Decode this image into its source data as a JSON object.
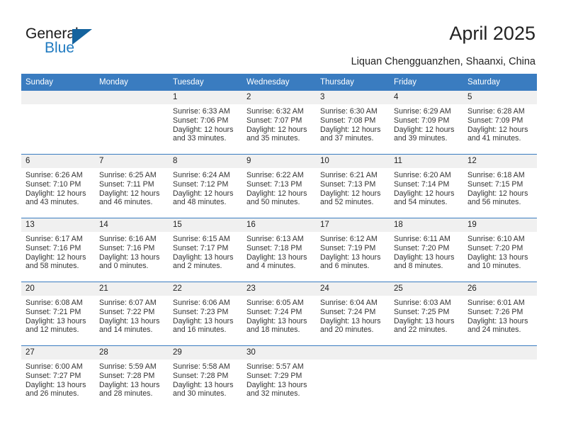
{
  "brand": {
    "word_general": "General",
    "word_blue": "Blue",
    "accent_color": "#1f7ac0",
    "triangle_color": "#14639e"
  },
  "header": {
    "title": "April 2025",
    "location": "Liquan Chengguanzhen, Shaanxi, China"
  },
  "calendar": {
    "header_bg": "#3a7cc0",
    "daynum_bg": "#f0f0f0",
    "weekday_headers": [
      "Sunday",
      "Monday",
      "Tuesday",
      "Wednesday",
      "Thursday",
      "Friday",
      "Saturday"
    ],
    "weeks": [
      [
        {
          "day": "",
          "empty": true,
          "lines": []
        },
        {
          "day": "",
          "empty": true,
          "lines": []
        },
        {
          "day": "1",
          "empty": false,
          "lines": [
            "Sunrise: 6:33 AM",
            "Sunset: 7:06 PM",
            "Daylight: 12 hours",
            "and 33 minutes."
          ]
        },
        {
          "day": "2",
          "empty": false,
          "lines": [
            "Sunrise: 6:32 AM",
            "Sunset: 7:07 PM",
            "Daylight: 12 hours",
            "and 35 minutes."
          ]
        },
        {
          "day": "3",
          "empty": false,
          "lines": [
            "Sunrise: 6:30 AM",
            "Sunset: 7:08 PM",
            "Daylight: 12 hours",
            "and 37 minutes."
          ]
        },
        {
          "day": "4",
          "empty": false,
          "lines": [
            "Sunrise: 6:29 AM",
            "Sunset: 7:09 PM",
            "Daylight: 12 hours",
            "and 39 minutes."
          ]
        },
        {
          "day": "5",
          "empty": false,
          "lines": [
            "Sunrise: 6:28 AM",
            "Sunset: 7:09 PM",
            "Daylight: 12 hours",
            "and 41 minutes."
          ]
        }
      ],
      [
        {
          "day": "6",
          "empty": false,
          "lines": [
            "Sunrise: 6:26 AM",
            "Sunset: 7:10 PM",
            "Daylight: 12 hours",
            "and 43 minutes."
          ]
        },
        {
          "day": "7",
          "empty": false,
          "lines": [
            "Sunrise: 6:25 AM",
            "Sunset: 7:11 PM",
            "Daylight: 12 hours",
            "and 46 minutes."
          ]
        },
        {
          "day": "8",
          "empty": false,
          "lines": [
            "Sunrise: 6:24 AM",
            "Sunset: 7:12 PM",
            "Daylight: 12 hours",
            "and 48 minutes."
          ]
        },
        {
          "day": "9",
          "empty": false,
          "lines": [
            "Sunrise: 6:22 AM",
            "Sunset: 7:13 PM",
            "Daylight: 12 hours",
            "and 50 minutes."
          ]
        },
        {
          "day": "10",
          "empty": false,
          "lines": [
            "Sunrise: 6:21 AM",
            "Sunset: 7:13 PM",
            "Daylight: 12 hours",
            "and 52 minutes."
          ]
        },
        {
          "day": "11",
          "empty": false,
          "lines": [
            "Sunrise: 6:20 AM",
            "Sunset: 7:14 PM",
            "Daylight: 12 hours",
            "and 54 minutes."
          ]
        },
        {
          "day": "12",
          "empty": false,
          "lines": [
            "Sunrise: 6:18 AM",
            "Sunset: 7:15 PM",
            "Daylight: 12 hours",
            "and 56 minutes."
          ]
        }
      ],
      [
        {
          "day": "13",
          "empty": false,
          "lines": [
            "Sunrise: 6:17 AM",
            "Sunset: 7:16 PM",
            "Daylight: 12 hours",
            "and 58 minutes."
          ]
        },
        {
          "day": "14",
          "empty": false,
          "lines": [
            "Sunrise: 6:16 AM",
            "Sunset: 7:16 PM",
            "Daylight: 13 hours",
            "and 0 minutes."
          ]
        },
        {
          "day": "15",
          "empty": false,
          "lines": [
            "Sunrise: 6:15 AM",
            "Sunset: 7:17 PM",
            "Daylight: 13 hours",
            "and 2 minutes."
          ]
        },
        {
          "day": "16",
          "empty": false,
          "lines": [
            "Sunrise: 6:13 AM",
            "Sunset: 7:18 PM",
            "Daylight: 13 hours",
            "and 4 minutes."
          ]
        },
        {
          "day": "17",
          "empty": false,
          "lines": [
            "Sunrise: 6:12 AM",
            "Sunset: 7:19 PM",
            "Daylight: 13 hours",
            "and 6 minutes."
          ]
        },
        {
          "day": "18",
          "empty": false,
          "lines": [
            "Sunrise: 6:11 AM",
            "Sunset: 7:20 PM",
            "Daylight: 13 hours",
            "and 8 minutes."
          ]
        },
        {
          "day": "19",
          "empty": false,
          "lines": [
            "Sunrise: 6:10 AM",
            "Sunset: 7:20 PM",
            "Daylight: 13 hours",
            "and 10 minutes."
          ]
        }
      ],
      [
        {
          "day": "20",
          "empty": false,
          "lines": [
            "Sunrise: 6:08 AM",
            "Sunset: 7:21 PM",
            "Daylight: 13 hours",
            "and 12 minutes."
          ]
        },
        {
          "day": "21",
          "empty": false,
          "lines": [
            "Sunrise: 6:07 AM",
            "Sunset: 7:22 PM",
            "Daylight: 13 hours",
            "and 14 minutes."
          ]
        },
        {
          "day": "22",
          "empty": false,
          "lines": [
            "Sunrise: 6:06 AM",
            "Sunset: 7:23 PM",
            "Daylight: 13 hours",
            "and 16 minutes."
          ]
        },
        {
          "day": "23",
          "empty": false,
          "lines": [
            "Sunrise: 6:05 AM",
            "Sunset: 7:24 PM",
            "Daylight: 13 hours",
            "and 18 minutes."
          ]
        },
        {
          "day": "24",
          "empty": false,
          "lines": [
            "Sunrise: 6:04 AM",
            "Sunset: 7:24 PM",
            "Daylight: 13 hours",
            "and 20 minutes."
          ]
        },
        {
          "day": "25",
          "empty": false,
          "lines": [
            "Sunrise: 6:03 AM",
            "Sunset: 7:25 PM",
            "Daylight: 13 hours",
            "and 22 minutes."
          ]
        },
        {
          "day": "26",
          "empty": false,
          "lines": [
            "Sunrise: 6:01 AM",
            "Sunset: 7:26 PM",
            "Daylight: 13 hours",
            "and 24 minutes."
          ]
        }
      ],
      [
        {
          "day": "27",
          "empty": false,
          "lines": [
            "Sunrise: 6:00 AM",
            "Sunset: 7:27 PM",
            "Daylight: 13 hours",
            "and 26 minutes."
          ]
        },
        {
          "day": "28",
          "empty": false,
          "lines": [
            "Sunrise: 5:59 AM",
            "Sunset: 7:28 PM",
            "Daylight: 13 hours",
            "and 28 minutes."
          ]
        },
        {
          "day": "29",
          "empty": false,
          "lines": [
            "Sunrise: 5:58 AM",
            "Sunset: 7:28 PM",
            "Daylight: 13 hours",
            "and 30 minutes."
          ]
        },
        {
          "day": "30",
          "empty": false,
          "lines": [
            "Sunrise: 5:57 AM",
            "Sunset: 7:29 PM",
            "Daylight: 13 hours",
            "and 32 minutes."
          ]
        },
        {
          "day": "",
          "empty": true,
          "lines": []
        },
        {
          "day": "",
          "empty": true,
          "lines": []
        },
        {
          "day": "",
          "empty": true,
          "lines": []
        }
      ]
    ]
  }
}
